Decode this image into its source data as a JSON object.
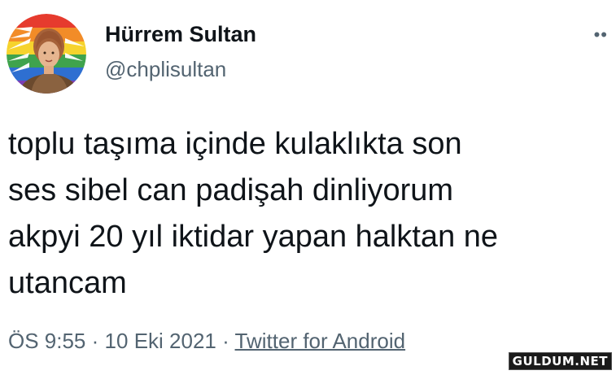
{
  "tweet": {
    "author": {
      "display_name": "Hürrem Sultan",
      "handle": "@chplisultan",
      "avatar": "woman-portrait-on-rainbow-party-logo"
    },
    "text": "toplu taşıma içinde kulaklıkta son\nses sibel can padişah dinliyorum\nakpyi 20 yıl iktidar yapan halktan ne\nutancam",
    "time": "ÖS 9:55",
    "separator": "·",
    "date": "10 Eki 2021",
    "source": "Twitter for Android",
    "more_icon": "more-dots-icon"
  },
  "watermark": "GULDUM.NET"
}
